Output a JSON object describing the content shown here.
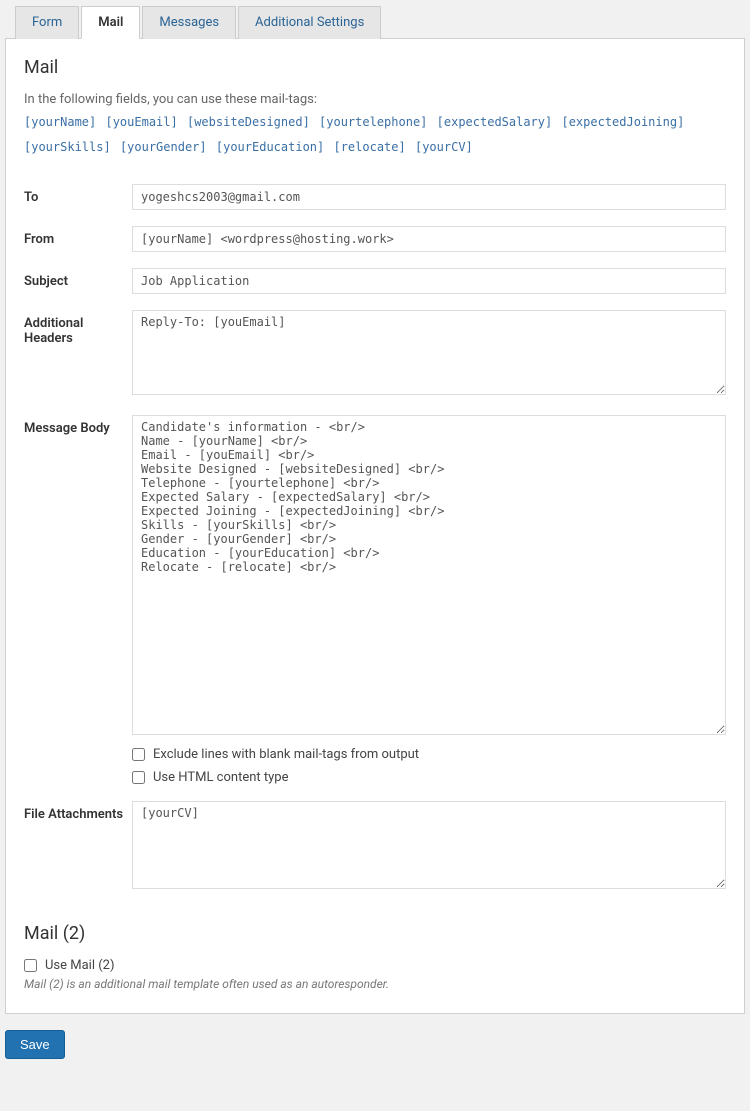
{
  "tabs": {
    "form": "Form",
    "mail": "Mail",
    "messages": "Messages",
    "additional": "Additional Settings"
  },
  "section_title": "Mail",
  "hint": "In the following fields, you can use these mail-tags:",
  "mailtags": [
    "[yourName]",
    "[youEmail]",
    "[websiteDesigned]",
    "[yourtelephone]",
    "[expectedSalary]",
    "[expectedJoining]",
    "[yourSkills]",
    "[yourGender]",
    "[yourEducation]",
    "[relocate]",
    "[yourCV]"
  ],
  "labels": {
    "to": "To",
    "from": "From",
    "subject": "Subject",
    "additional_headers": "Additional Headers",
    "message_body": "Message Body",
    "file_attachments": "File Attachments"
  },
  "values": {
    "to": "yogeshcs2003@gmail.com",
    "from": "[yourName] <wordpress@hosting.work>",
    "subject": "Job Application",
    "additional_headers": "Reply-To: [youEmail]",
    "message_body": "Candidate's information - <br/>\nName - [yourName] <br/>\nEmail - [youEmail] <br/>\nWebsite Designed - [websiteDesigned] <br/>\nTelephone - [yourtelephone] <br/>\nExpected Salary - [expectedSalary] <br/>\nExpected Joining - [expectedJoining] <br/>\nSkills - [yourSkills] <br/>\nGender - [yourGender] <br/>\nEducation - [yourEducation] <br/>\nRelocate - [relocate] <br/>",
    "file_attachments": "[yourCV]"
  },
  "checkboxes": {
    "exclude_blank": "Exclude lines with blank mail-tags from output",
    "use_html": "Use HTML content type"
  },
  "mail2": {
    "title": "Mail (2)",
    "checkbox": "Use Mail (2)",
    "desc": "Mail (2) is an additional mail template often used as an autoresponder."
  },
  "save_label": "Save"
}
